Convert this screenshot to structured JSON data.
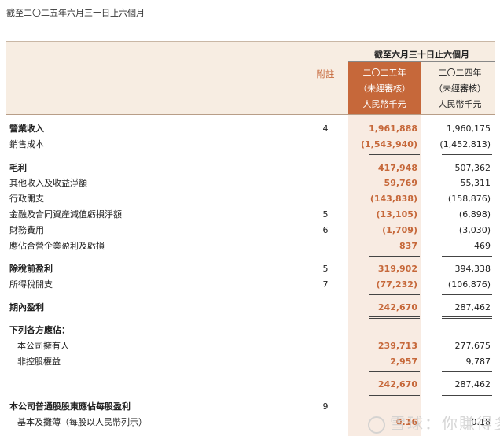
{
  "caption": "截至二〇二五年六月三十日止六個月",
  "header": {
    "group": "截至六月三十日止六個月",
    "note_label": "附註",
    "current": [
      "二〇二五年",
      "（未經審核）",
      "人民幣千元"
    ],
    "prior": [
      "二〇二四年",
      "（未經審核）",
      "人民幣千元"
    ]
  },
  "rows": [
    {
      "label": "營業收入",
      "note": "4",
      "cur": "1,961,888",
      "prev": "1,960,175"
    },
    {
      "label": "銷售成本",
      "note": "",
      "cur": "(1,543,940)",
      "prev": "(1,452,813)"
    },
    {
      "label": "毛利",
      "note": "",
      "cur": "417,948",
      "prev": "507,362"
    },
    {
      "label": "其他收入及收益淨額",
      "note": "",
      "cur": "59,769",
      "prev": "55,311"
    },
    {
      "label": "行政開支",
      "note": "",
      "cur": "(143,838)",
      "prev": "(158,876)"
    },
    {
      "label": "金融及合同資產減值虧損淨額",
      "note": "5",
      "cur": "(13,105)",
      "prev": "(6,898)"
    },
    {
      "label": "財務費用",
      "note": "6",
      "cur": "(1,709)",
      "prev": "(3,030)"
    },
    {
      "label": "應佔合營企業盈利及虧損",
      "note": "",
      "cur": "837",
      "prev": "469"
    },
    {
      "label": "除稅前盈利",
      "note": "5",
      "cur": "319,902",
      "prev": "394,338"
    },
    {
      "label": "所得稅開支",
      "note": "7",
      "cur": "(77,232)",
      "prev": "(106,876)"
    },
    {
      "label": "期內盈利",
      "note": "",
      "cur": "242,670",
      "prev": "287,462"
    },
    {
      "label": "下列各方應佔：",
      "note": "",
      "cur": "",
      "prev": ""
    },
    {
      "label": "本公司擁有人",
      "note": "",
      "cur": "239,713",
      "prev": "277,675"
    },
    {
      "label": "非控股權益",
      "note": "",
      "cur": "2,957",
      "prev": "9,787"
    },
    {
      "label": "",
      "note": "",
      "cur": "242,670",
      "prev": "287,462"
    },
    {
      "label": "本公司普通股股東應佔每股盈利",
      "note": "9",
      "cur": "",
      "prev": ""
    },
    {
      "label": "基本及攤薄（每股以人民幣列示）",
      "note": "",
      "cur": "0.16",
      "prev": "0.18"
    }
  ],
  "watermark": "雪球：你賺得多"
}
